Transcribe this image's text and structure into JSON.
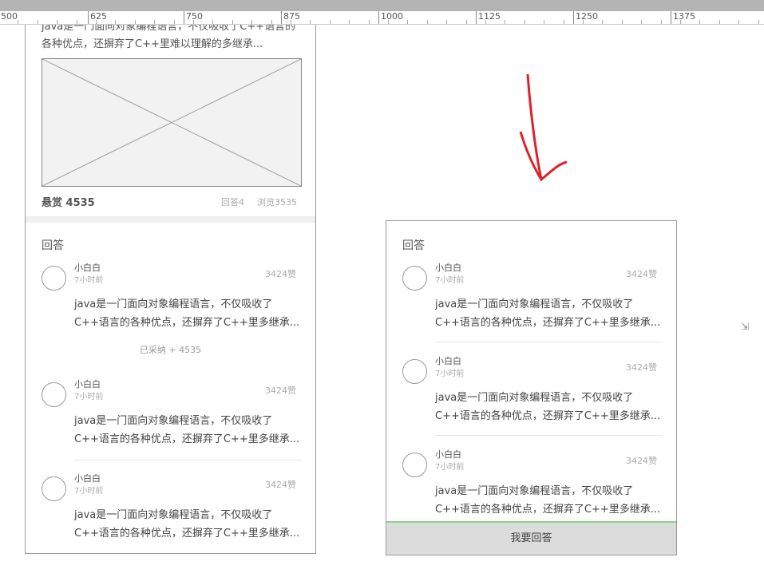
{
  "ruler": {
    "labels": [
      "500",
      "625",
      "750",
      "875",
      "1000",
      "1125",
      "1250",
      "1375"
    ]
  },
  "question": {
    "intro": "java是一门面向对象编程语言，不仅吸收了C++语言的各种优点，还摒弃了C++里难以理解的多继承...",
    "reward": "悬赏 4535",
    "answers_count": "回答4",
    "views": "浏览3535"
  },
  "left": {
    "section_title": "回答",
    "answers": [
      {
        "name": "小白白",
        "time": "7小时前",
        "likes": "3424赞",
        "body": "java是一门面向对象编程语言，不仅吸收了C++语言的各种优点，还摒弃了C++里多继承...",
        "adopted": "已采纳 + 4535"
      },
      {
        "name": "小白白",
        "time": "7小时前",
        "likes": "3424赞",
        "body": "java是一门面向对象编程语言，不仅吸收了C++语言的各种优点，还摒弃了C++里多继承..."
      },
      {
        "name": "小白白",
        "time": "7小时前",
        "likes": "3424赞",
        "body": "java是一门面向对象编程语言，不仅吸收了C++语言的各种优点，还摒弃了C++里多继承..."
      }
    ]
  },
  "right": {
    "section_title": "回答",
    "answers": [
      {
        "name": "小白白",
        "time": "7小时前",
        "likes": "3424赞",
        "body": "java是一门面向对象编程语言，不仅吸收了C++语言的各种优点，还摒弃了C++里多继承..."
      },
      {
        "name": "小白白",
        "time": "7小时前",
        "likes": "3424赞",
        "body": "java是一门面向对象编程语言，不仅吸收了C++语言的各种优点，还摒弃了C++里多继承..."
      },
      {
        "name": "小白白",
        "time": "7小时前",
        "likes": "3424赞",
        "body": "java是一门面向对象编程语言，不仅吸收了C++语言的各种优点，还摒弃了C++里多继承..."
      }
    ],
    "answer_button": "我要回答"
  },
  "colors": {
    "annotation_arrow": "#e0202a",
    "button_bg": "#dcdcdc",
    "button_accent": "#8fd18f"
  }
}
